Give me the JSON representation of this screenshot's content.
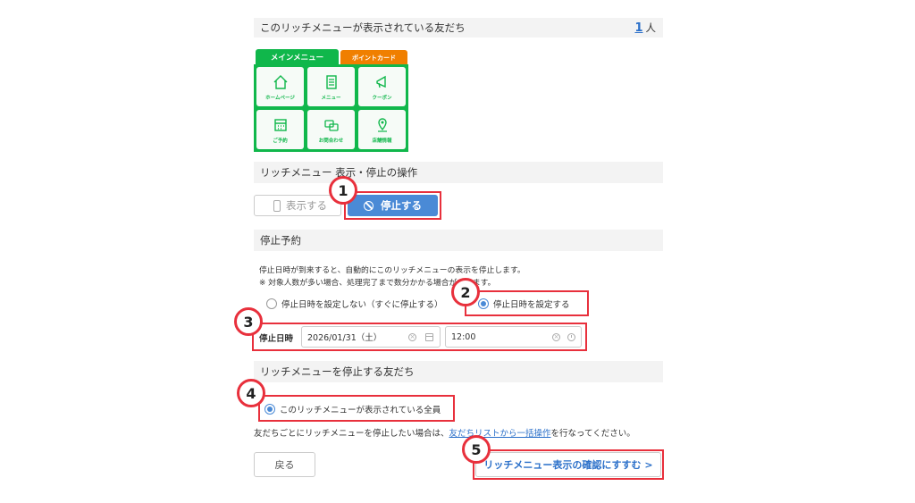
{
  "friends_shown": {
    "label": "このリッチメニューが表示されている友だち",
    "count": "1",
    "unit": "人"
  },
  "rich_menu": {
    "tab_main": "メインメニュー",
    "tab_point": "ポイントカード",
    "cells": [
      "ホームページ",
      "メニュー",
      "クーポン",
      "ご予約",
      "お問合わせ",
      "店舗情報"
    ]
  },
  "display_section": {
    "title": "リッチメニュー 表示・停止の操作",
    "show_label": "表示する",
    "stop_label": "停止する"
  },
  "schedule": {
    "title": "停止予約",
    "desc1": "停止日時が到来すると、自動的にこのリッチメニューの表示を停止します。",
    "desc2": "※ 対象人数が多い場合、処理完了まで数分かかる場合があります。",
    "option_no_date": "停止日時を設定しない（すぐに停止する）",
    "option_set_date": "停止日時を設定する",
    "datetime_label": "停止日時",
    "date_value": "2026/01/31（土）",
    "time_value": "12:00"
  },
  "target": {
    "title": "リッチメニューを停止する友だち",
    "option_all": "このリッチメニューが表示されている全員",
    "note_before": "友だちごとにリッチメニューを停止したい場合は、",
    "note_link": "友だちリストから一括操作",
    "note_after": "を行なってください。"
  },
  "footer": {
    "back_label": "戻る",
    "confirm_label": "リッチメニュー表示の確認にすすむ >"
  },
  "badges": [
    "1",
    "2",
    "3",
    "4",
    "5"
  ],
  "colors": {
    "accent_blue": "#4a8ad6",
    "line_green": "#10b74b",
    "point_orange": "#f07f00",
    "highlight_red": "#e8303c"
  }
}
